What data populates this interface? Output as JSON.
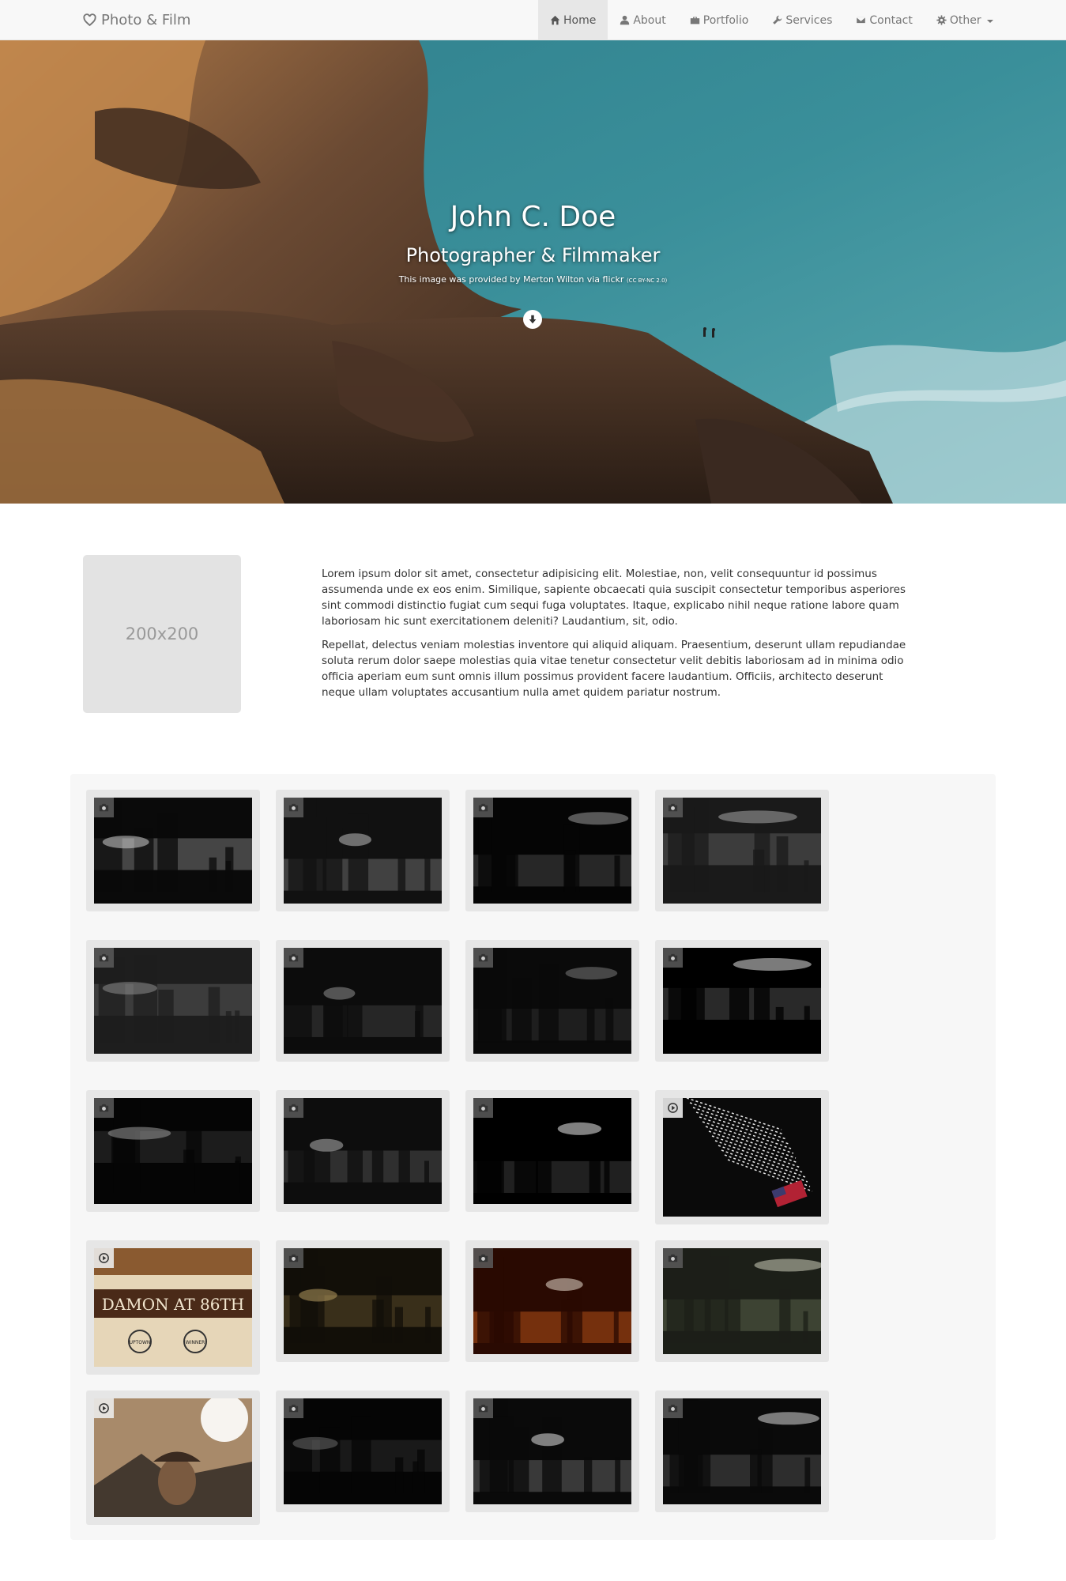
{
  "navbar": {
    "brand": "Photo & Film",
    "items": [
      {
        "label": "Home",
        "icon": "home-icon",
        "active": true
      },
      {
        "label": "About",
        "icon": "user-icon"
      },
      {
        "label": "Portfolio",
        "icon": "briefcase-icon"
      },
      {
        "label": "Services",
        "icon": "wrench-icon"
      },
      {
        "label": "Contact",
        "icon": "envelope-icon"
      },
      {
        "label": "Other",
        "icon": "gear-icon",
        "dropdown": true
      }
    ]
  },
  "hero": {
    "name": "John C. Doe",
    "subtitle": "Photographer & Filmmaker",
    "credit": "This image was provided by Merton Wilton via flickr",
    "license": "(CC BY-NC 2.0)"
  },
  "about": {
    "avatar_placeholder": "200x200",
    "paragraphs": [
      "Lorem ipsum dolor sit amet, consectetur adipisicing elit. Molestiae, non, velit consequuntur id possimus assumenda unde ex eos enim. Similique, sapiente obcaecati quia suscipit consectetur temporibus asperiores sint commodi distinctio fugiat cum sequi fuga voluptates. Itaque, explicabo nihil neque ratione labore quam laboriosam hic sunt exercitationem deleniti? Laudantium, sit, odio.",
      "Repellat, delectus veniam molestias inventore qui aliquid aliquam. Praesentium, deserunt ullam repudiandae soluta rerum dolor saepe molestias quia vitae tenetur consectetur velit debitis laboriosam ad in minima odio officia aperiam eum sunt omnis illum possimus provident facere laudantium. Officiis, architecto deserunt neque ullam voluptates accusantium nulla amet quidem pariatur nostrum."
    ]
  },
  "gallery": {
    "items": [
      {
        "type": "photo",
        "palette": [
          "#0a0a0a",
          "#777777",
          "#d0d0d0"
        ]
      },
      {
        "type": "photo",
        "palette": [
          "#111111",
          "#6a6a6a",
          "#bdbdbd"
        ]
      },
      {
        "type": "photo",
        "palette": [
          "#050505",
          "#444444",
          "#9a9a9a"
        ]
      },
      {
        "type": "photo",
        "palette": [
          "#1a1a1a",
          "#5a5a5a",
          "#a8a8a8"
        ]
      },
      {
        "type": "photo",
        "palette": [
          "#1e1e1e",
          "#555555",
          "#8d8d8d"
        ]
      },
      {
        "type": "photo",
        "palette": [
          "#0c0c0c",
          "#3d3d3d",
          "#8f8f8f"
        ]
      },
      {
        "type": "photo",
        "palette": [
          "#0a0a0a",
          "#2f2f2f",
          "#7a7a7a"
        ]
      },
      {
        "type": "photo",
        "palette": [
          "#000000",
          "#4a4a4a",
          "#e0e0e0"
        ]
      },
      {
        "type": "photo",
        "palette": [
          "#050505",
          "#303030",
          "#9b9b9b"
        ]
      },
      {
        "type": "photo",
        "palette": [
          "#0d0d0d",
          "#4d4d4d",
          "#b5b5b5"
        ]
      },
      {
        "type": "photo",
        "palette": [
          "#000000",
          "#3a3a3a",
          "#e8e8e8"
        ]
      },
      {
        "type": "video",
        "palette": [
          "#0a0a0a",
          "#1a1a1a",
          "#e8e8e8"
        ],
        "accent": "#b22234"
      },
      {
        "type": "video",
        "palette": [
          "#4a2a18",
          "#8a5a30",
          "#e6d6b8"
        ],
        "poster_title": "DAMON AT 86TH",
        "laurels": [
          "UPTOWN",
          "WINNER"
        ]
      },
      {
        "type": "photo",
        "palette": [
          "#120f08",
          "#5a4a2a",
          "#b59a60"
        ]
      },
      {
        "type": "photo",
        "palette": [
          "#2a0a02",
          "#b25018",
          "#e8dccf"
        ]
      },
      {
        "type": "photo",
        "palette": [
          "#1c1f18",
          "#59604a",
          "#cfd0bd"
        ]
      },
      {
        "type": "video",
        "palette": [
          "#2a2420",
          "#a88a6a",
          "#ffffff"
        ]
      },
      {
        "type": "photo",
        "palette": [
          "#050505",
          "#2a2a2a",
          "#6a6a6a"
        ]
      },
      {
        "type": "photo",
        "palette": [
          "#0a0a0a",
          "#606060",
          "#e0e0e0"
        ]
      },
      {
        "type": "photo",
        "palette": [
          "#0a0a0a",
          "#4a4a4a",
          "#d8d8d8"
        ]
      }
    ]
  }
}
